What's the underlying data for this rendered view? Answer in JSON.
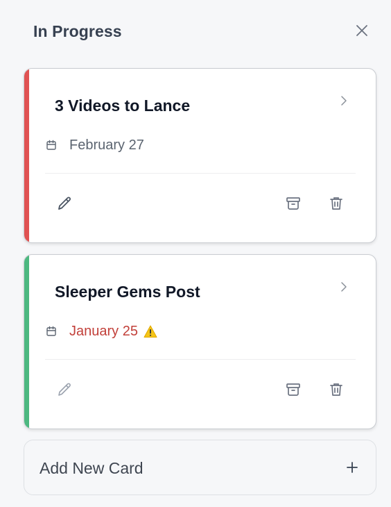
{
  "column": {
    "title": "In Progress"
  },
  "cards": [
    {
      "title": "3 Videos to Lance",
      "date": "February 27",
      "accent_color": "#e05252",
      "date_color": "#5b6470",
      "overdue": false
    },
    {
      "title": "Sleeper Gems Post",
      "date": "January 25",
      "accent_color": "#4cb880",
      "date_color": "#c2403a",
      "overdue": true
    }
  ],
  "add_card": {
    "label": "Add New Card"
  },
  "icons": {
    "close": "close-icon",
    "chevron": "chevron-right-icon",
    "calendar": "calendar-icon",
    "warning": "warning-icon",
    "edit": "pencil-icon",
    "archive": "archive-icon",
    "delete": "trash-icon",
    "add": "plus-icon"
  }
}
